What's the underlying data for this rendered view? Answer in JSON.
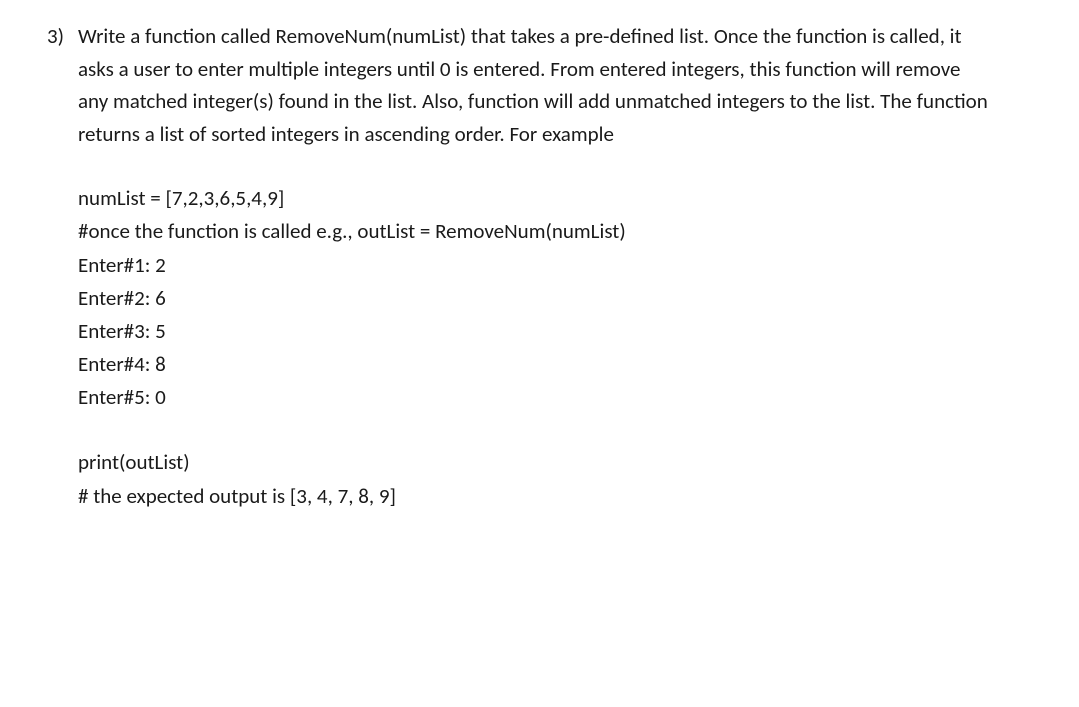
{
  "question": {
    "marker": "3)",
    "description": "Write a function called RemoveNum(numList) that takes a pre-defined list. Once the function is called, it asks a user to enter multiple integers until 0 is entered. From entered integers, this function will remove any matched integer(s) found in the list. Also, function will add unmatched integers to the list. The function returns a list of sorted integers in ascending order. For example",
    "code_lines": [
      "numList = [7,2,3,6,5,4,9]",
      "#once the function is called e.g., outList = RemoveNum(numList)",
      "Enter#1: 2",
      "Enter#2: 6",
      "Enter#3: 5",
      "Enter#4: 8",
      "Enter#5: 0"
    ],
    "output_lines": [
      "print(outList)",
      "# the expected output is [3, 4, 7, 8, 9]"
    ]
  }
}
